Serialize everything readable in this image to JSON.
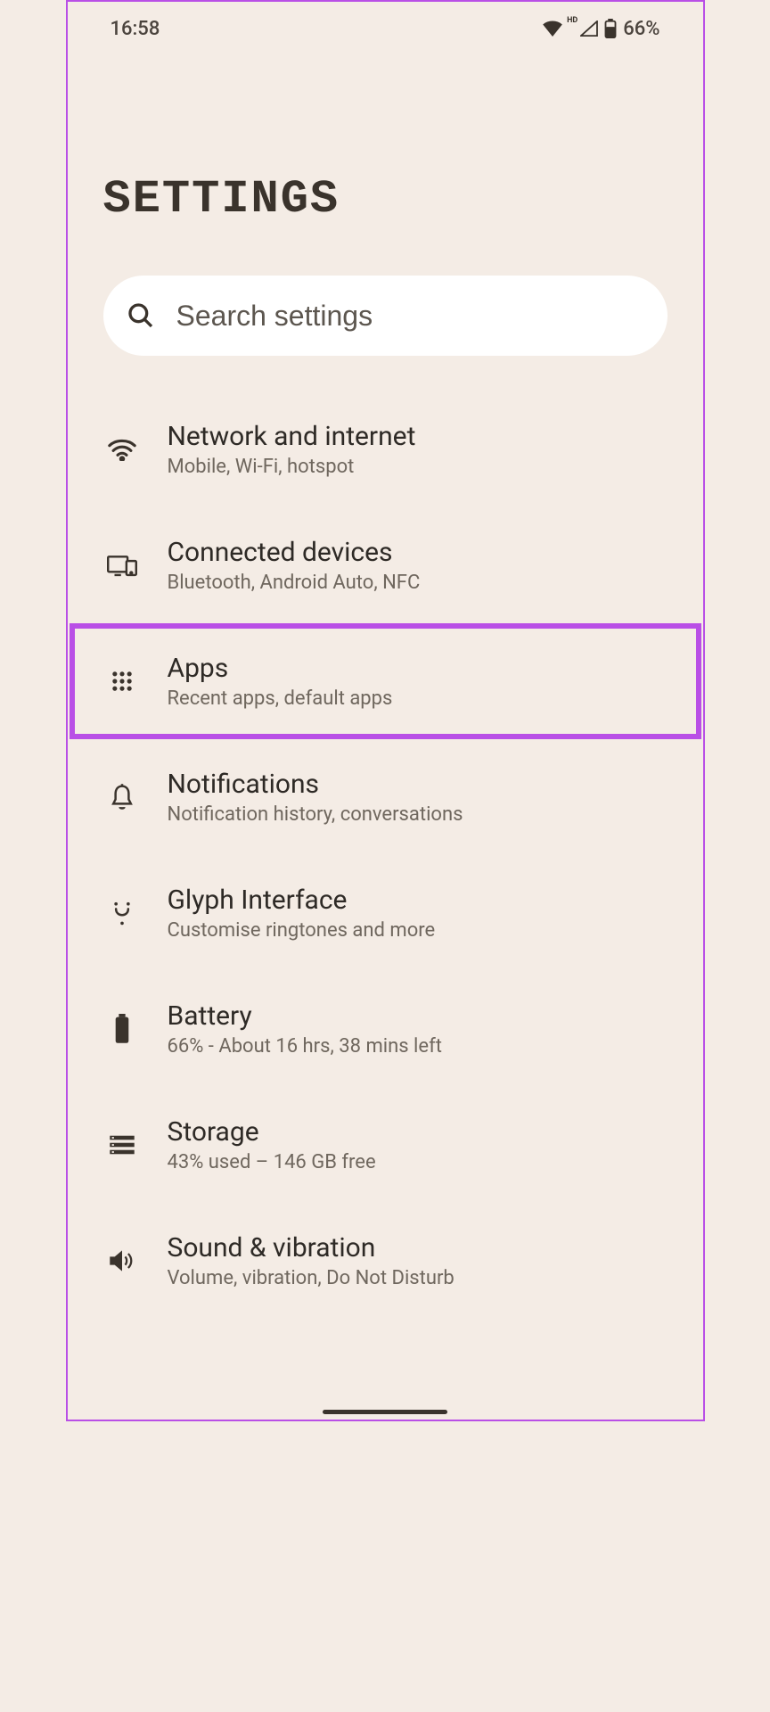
{
  "status": {
    "time": "16:58",
    "hd_label": "HD",
    "battery_percent": "66%"
  },
  "header": {
    "title": "SETTINGS"
  },
  "search": {
    "placeholder": "Search settings"
  },
  "items": [
    {
      "icon": "wifi",
      "title": "Network and internet",
      "subtitle": "Mobile, Wi-Fi, hotspot",
      "highlighted": false
    },
    {
      "icon": "devices",
      "title": "Connected devices",
      "subtitle": "Bluetooth, Android Auto, NFC",
      "highlighted": false
    },
    {
      "icon": "apps",
      "title": "Apps",
      "subtitle": "Recent apps, default apps",
      "highlighted": true
    },
    {
      "icon": "bell",
      "title": "Notifications",
      "subtitle": "Notification history, conversations",
      "highlighted": false
    },
    {
      "icon": "glyph",
      "title": "Glyph Interface",
      "subtitle": "Customise ringtones and more",
      "highlighted": false
    },
    {
      "icon": "battery",
      "title": "Battery",
      "subtitle": "66% - About 16 hrs, 38 mins left",
      "highlighted": false
    },
    {
      "icon": "storage",
      "title": "Storage",
      "subtitle": "43% used – 146 GB free",
      "highlighted": false
    },
    {
      "icon": "sound",
      "title": "Sound & vibration",
      "subtitle": "Volume, vibration, Do Not Disturb",
      "highlighted": false
    }
  ]
}
